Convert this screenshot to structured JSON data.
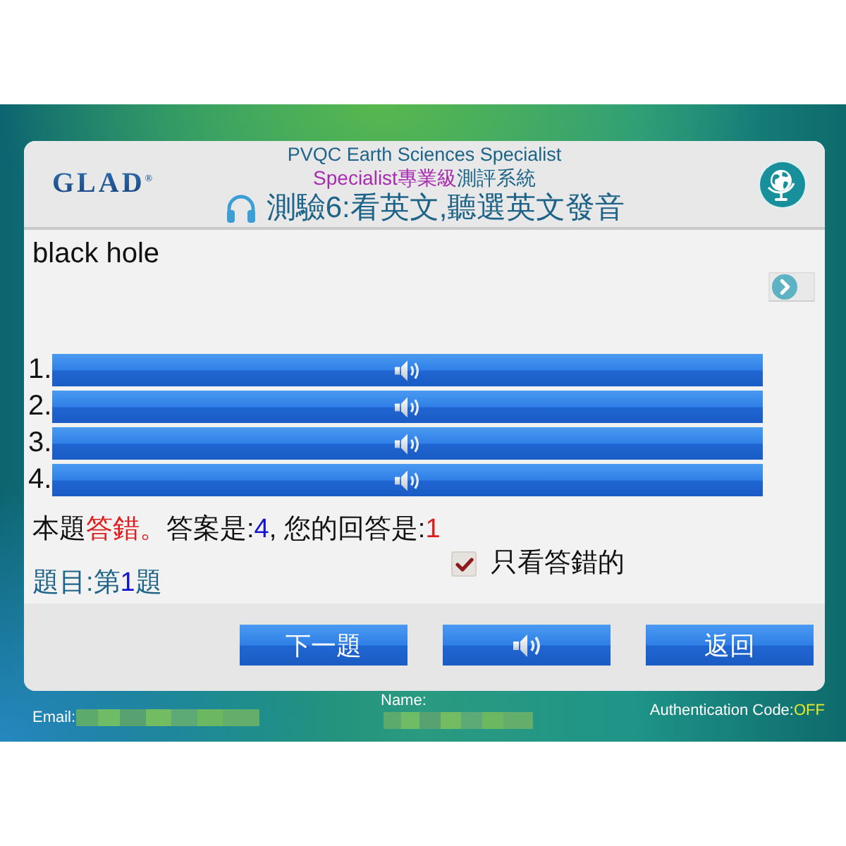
{
  "header": {
    "logo": "GLAD$^{®}$",
    "title": "PVQC Earth Sciences Specialist",
    "subtitle": [
      {
        "kind": "highlight",
        "text": "Specialist專業級"
      },
      {
        "kind": "plain",
        "text": "測評系統"
      }
    ],
    "quiz_title": "測驗6:看英文,聽選英文發音"
  },
  "word": "black hole",
  "options": [
    {
      "number": "1."
    },
    {
      "number": "2."
    },
    {
      "number": "3."
    },
    {
      "number": "4."
    }
  ],
  "result": [
    {
      "kind": "plain",
      "text": "本題"
    },
    {
      "kind": "wrong",
      "text": "答錯。"
    },
    {
      "kind": "plain",
      "text": "答案是:"
    },
    {
      "kind": "correct",
      "text": "4"
    },
    {
      "kind": "plain",
      "text": ", 您的回答是:"
    },
    {
      "kind": "wrong",
      "text": "1"
    }
  ],
  "filter": {
    "label": "只看答錯的",
    "checked": true
  },
  "question_number": [
    {
      "kind": "plain",
      "text": "題目:第"
    },
    {
      "kind": "number",
      "text": "1"
    },
    {
      "kind": "plain",
      "text": "題"
    }
  ],
  "buttons": [
    {
      "kind": "next",
      "label": "下一題"
    },
    {
      "kind": "audio"
    },
    {
      "kind": "back",
      "label": "返回"
    }
  ],
  "footer": {
    "email_label": "Email:",
    "name_label": "Name:",
    "auth_label": "Authentication Code:",
    "auth_value": "OFF"
  }
}
